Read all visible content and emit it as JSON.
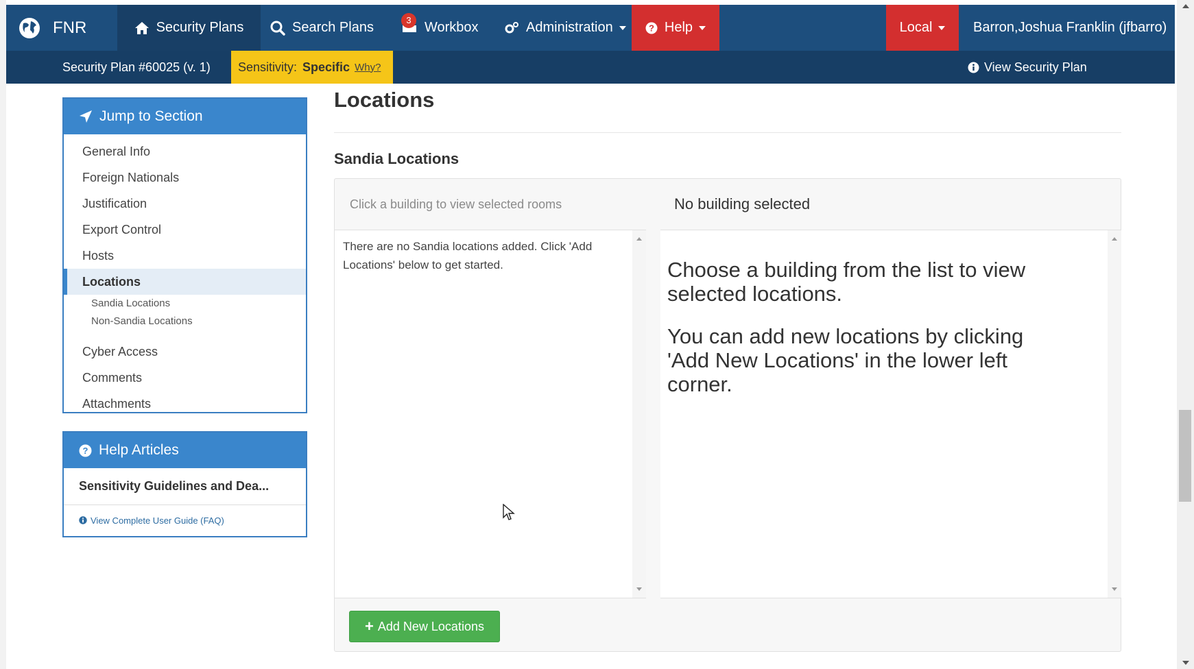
{
  "navbar": {
    "brand": "FNR",
    "items": {
      "security_plans": "Security Plans",
      "search_plans": "Search Plans",
      "workbox": "Workbox",
      "workbox_badge": "3",
      "administration": "Administration",
      "help": "Help",
      "local": "Local",
      "user": "Barron,Joshua Franklin (jfbarro)"
    },
    "colors": {
      "bar": "#1d4e7d",
      "active": "#183f66",
      "danger": "#d32f2f"
    }
  },
  "subnav": {
    "plan_title": "Security Plan #60025 (v. 1)",
    "sensitivity_label": "Sensitivity:",
    "sensitivity_value": "Specific",
    "why_link": "Why?",
    "view_plan": "View Security Plan"
  },
  "sidebar": {
    "jump_title": "Jump to Section",
    "items": [
      {
        "label": "General Info"
      },
      {
        "label": "Foreign Nationals"
      },
      {
        "label": "Justification"
      },
      {
        "label": "Export Control"
      },
      {
        "label": "Hosts"
      },
      {
        "label": "Locations",
        "active": true
      },
      {
        "label": "Cyber Access"
      },
      {
        "label": "Comments"
      },
      {
        "label": "Attachments"
      }
    ],
    "sub_items": [
      {
        "label": "Sandia Locations"
      },
      {
        "label": "Non-Sandia Locations"
      }
    ],
    "help_title": "Help Articles",
    "help_article": "Sensitivity Guidelines and Dea...",
    "faq_link": "View Complete User Guide (FAQ)"
  },
  "main": {
    "page_title": "Locations",
    "section_title": "Sandia Locations",
    "hint": "Click a building to view selected rooms",
    "selected": "No building selected",
    "empty_list": "There are no Sandia locations added. Click 'Add Locations' below to get started.",
    "detail_line1": "Choose a building from the list to view selected locations.",
    "detail_line2": "You can add new locations by clicking 'Add New Locations' in the lower left corner.",
    "add_button": "Add New Locations"
  }
}
